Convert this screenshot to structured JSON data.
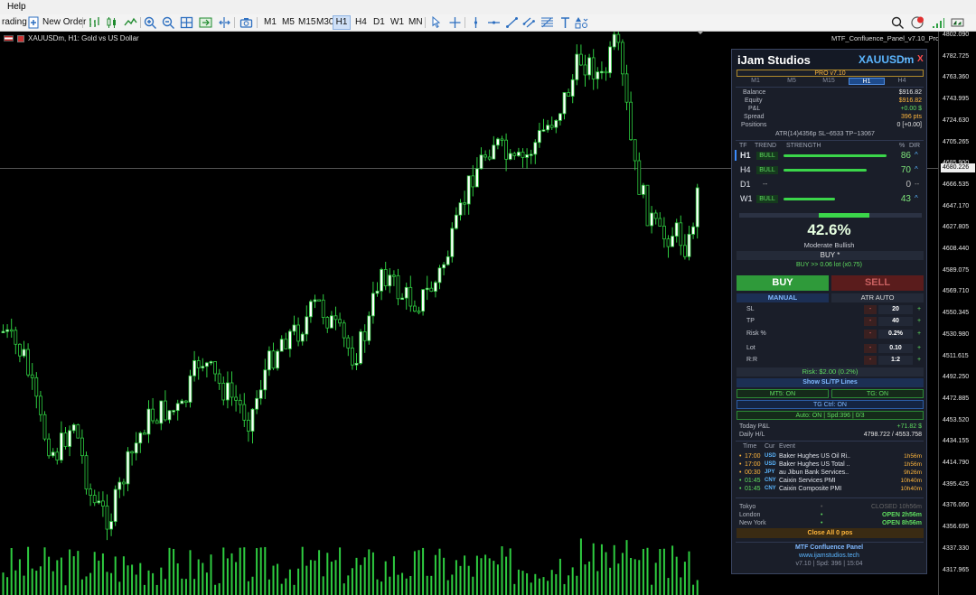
{
  "menubar": {
    "help": "Help"
  },
  "toolbar": {
    "trading": "rading",
    "new_order": "New Order",
    "timeframes": [
      "M1",
      "M5",
      "M15",
      "M30",
      "H1",
      "H4",
      "D1",
      "W1",
      "MN"
    ],
    "selected_timeframe": "H1",
    "notification_count": "1"
  },
  "chart": {
    "title": "XAUUSDm, H1:  Gold vs US Dollar",
    "indicator_label": "MTF_Confluence_Panel_v7.10_Pro",
    "bull_color": "#ffffff",
    "wick_color": "#2ecc40",
    "current_price_label": "4680.226",
    "axis_ticks": [
      "4802.090",
      "4782.725",
      "4763.360",
      "4743.995",
      "4724.630",
      "4705.265",
      "4685.900",
      "4666.535",
      "4647.170",
      "4627.805",
      "4608.440",
      "4589.075",
      "4569.710",
      "4550.345",
      "4530.980",
      "4511.615",
      "4492.250",
      "4472.885",
      "4453.520",
      "4434.155",
      "4414.790",
      "4395.425",
      "4376.060",
      "4356.695",
      "4337.330",
      "4317.965"
    ]
  },
  "panel": {
    "brand": "iJam Studios",
    "symbol": "XAUUSDm",
    "minimize": "-",
    "close": "X",
    "version_badge": "PRO v7.10",
    "tabs": [
      "M1",
      "M5",
      "M15",
      "H1",
      "H4"
    ],
    "active_tab": "H1",
    "account": [
      {
        "label": "Balance",
        "value": "$916.82",
        "color": "#e6e6e6"
      },
      {
        "label": "Equity",
        "value": "$916.82",
        "color": "#ffb63c"
      },
      {
        "label": "P&L",
        "value": "+0.00 $",
        "color": "#e6e6e6"
      },
      {
        "label": "Spread",
        "value": "396 pts",
        "color": "#ffb63c"
      },
      {
        "label": "Positions",
        "value": "0 [+0.00]",
        "color": "#e6e6e6"
      }
    ],
    "atr_line": "ATR(14)4356p  SL~6533  TP~13067",
    "table_headers": {
      "tf": "TF",
      "trend": "TREND",
      "strength": "STRENGTH",
      "pct": "%",
      "dir": "DIR"
    },
    "timeframes": [
      {
        "tf": "H1",
        "trend": "BULL",
        "strength": 86,
        "pct": "86",
        "dir": "^"
      },
      {
        "tf": "H4",
        "trend": "BULL",
        "strength": 70,
        "pct": "70",
        "dir": "^"
      },
      {
        "tf": "D1",
        "trend": "--",
        "strength": 0,
        "pct": "0",
        "dir": "--"
      },
      {
        "tf": "W1",
        "trend": "BULL",
        "strength": 43,
        "pct": "43",
        "dir": "^"
      }
    ],
    "confluence": {
      "score": "42.6%",
      "bias": "Moderate Bullish",
      "signal": "BUY *",
      "lot_hint": "BUY >> 0.06 lot (x0.75)"
    },
    "buy_label": "BUY",
    "sell_label": "SELL",
    "mode_manual": "MANUAL",
    "mode_auto": "ATR AUTO",
    "fields": [
      {
        "label": "SL",
        "value": "20"
      },
      {
        "label": "TP",
        "value": "40"
      },
      {
        "label": "Risk %",
        "value": "0.2%"
      },
      {
        "label": "Lot",
        "value": "0.10"
      },
      {
        "label": "R:R",
        "value": "1:2"
      }
    ],
    "stepper_minus": "-",
    "stepper_plus": "+",
    "risk_line": "Risk: $2.00 (0.2%)",
    "show_sltp": "Show SL/TP Lines",
    "mt5_status": "MT5: ON",
    "tg_status": "TG: ON",
    "tg_ctrl": "TG Ctrl: ON",
    "auto_status": "Auto: ON | Spd:396 | 0/3",
    "today_pnl": {
      "label": "Today P&L",
      "value": "+71.82 $"
    },
    "daily_hl": {
      "label": "Daily H/L",
      "value": "4798.722 / 4553.758"
    },
    "event_headers": {
      "time": "Time",
      "cur": "Cur",
      "event": "Event"
    },
    "events": [
      {
        "time": "17:00",
        "cur": "USD",
        "name": "Baker Hughes US Oil Ri..",
        "eta": "1h56m"
      },
      {
        "time": "17:00",
        "cur": "USD",
        "name": "Baker Hughes US Total ..",
        "eta": "1h56m"
      },
      {
        "time": "00:30",
        "cur": "JPY",
        "name": "au Jibun Bank Services..",
        "eta": "9h26m"
      },
      {
        "time": "01:45",
        "cur": "CNY",
        "name": "Caixin Services PMI",
        "eta": "10h40m"
      },
      {
        "time": "01:45",
        "cur": "CNY",
        "name": "Caixin Composite PMI",
        "eta": "10h40m"
      }
    ],
    "sessions": [
      {
        "name": "Tokyo",
        "status": "CLOSED  10h56m",
        "open": false
      },
      {
        "name": "London",
        "status": "OPEN  2h56m",
        "open": true
      },
      {
        "name": "New York",
        "status": "OPEN  8h56m",
        "open": true
      }
    ],
    "close_all": "Close All 0 pos",
    "footer": {
      "name": "MTF Confluence Panel",
      "url": "www.ijamstudios.tech",
      "info": "v7.10  |  Spd: 396  |  15:04"
    }
  }
}
